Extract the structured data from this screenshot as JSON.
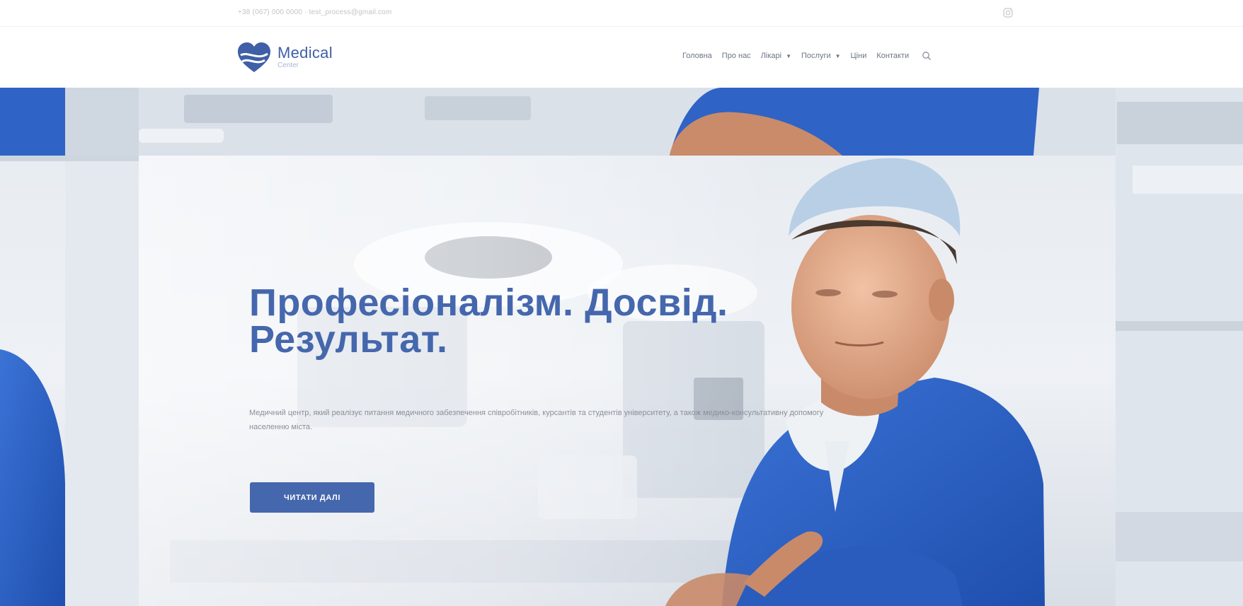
{
  "topbar": {
    "contact": "+38 (067) 000 0000 · test_process@gmail.com",
    "social_icon": "instagram-icon"
  },
  "header": {
    "logo": {
      "main": "Medical",
      "sub": "Center",
      "icon": "heart-logo-icon",
      "color": "#3f5fa6"
    },
    "nav": [
      {
        "label": "Головна",
        "dropdown": false
      },
      {
        "label": "Про нас",
        "dropdown": false
      },
      {
        "label": "Лікарі",
        "dropdown": true
      },
      {
        "label": "Послуги",
        "dropdown": true
      },
      {
        "label": "Ціни",
        "dropdown": false
      },
      {
        "label": "Контакти",
        "dropdown": false
      }
    ],
    "search_icon": "search-icon"
  },
  "hero": {
    "title_line1": "Професіоналізм. Досвід.",
    "title_line2": "Результат.",
    "text": "Медичний центр, який реалізує питання медичного забезпечення співробітників, курсантів та студентів університету, а також медико-консультативну допомогу населенню міста.",
    "button": "ЧИТАТИ ДАЛІ",
    "accent_color": "#4567ad",
    "scrub_color": "#2f63c6"
  }
}
